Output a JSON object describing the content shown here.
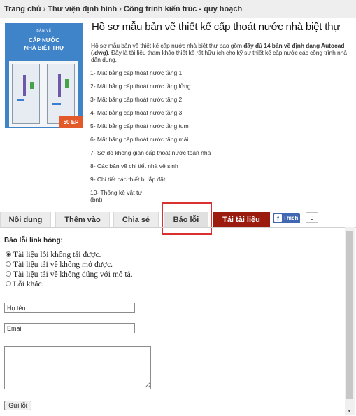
{
  "breadcrumb": {
    "items": [
      "Trang chủ",
      "Thư viện định hình",
      "Công trình kiến trúc - quy hoạch"
    ],
    "separator": "›"
  },
  "thumbnail": {
    "kicker": "BẢN VẼ",
    "title_line1": "CẤP NƯỚC",
    "title_line2": "NHÀ BIỆT THỰ",
    "badge": "50 EP"
  },
  "document": {
    "title": "Hồ sơ mẫu bản vẽ thiết kế cấp thoát nước nhà biệt thự",
    "desc_part1": "Hồ sơ mẫu bản vẽ thiết kế cấp nước nhà biệt thự bao gồm ",
    "desc_bold": "đầy đủ 14 bản vẽ định dạng Autocad (.dwg)",
    "desc_part2": ". Đây là tài liệu tham khảo thiết kế rất hữu ích cho kỹ sư thiết kế cấp nước các công trình nhà dân dụng.",
    "items": [
      "1- Mặt bằng cấp thoát nước tầng 1",
      "2- Mặt bằng cấp thoát nước tầng lửng",
      "3- Mặt bằng cấp thoát nước tầng 2",
      "4- Mặt bằng cấp thoát nước tầng 3",
      "5- Mặt bằng cấp thoát nước tầng tum",
      "6- Mặt bằng cấp thoát nước tầng mái",
      "7- Sơ đồ không gian cấp thoát nước toàn nhà",
      "8- Các bản vẽ chi tiết nhà vệ sinh",
      "9- Chi tiết các thiết bị lắp đặt",
      "10- Thống kê vật tư",
      "(bnt)"
    ]
  },
  "tabs": [
    {
      "label": "Nội dung"
    },
    {
      "label": "Thêm vào"
    },
    {
      "label": "Chia sẻ"
    },
    {
      "label": "Báo lỗi"
    },
    {
      "label": "Tải tài liệu"
    }
  ],
  "facebook": {
    "like_label": "Thích",
    "fb_glyph": "f",
    "count": "0"
  },
  "report_form": {
    "title": "Báo lỗi link hỏng:",
    "options": [
      "Tài liệu lỗi không tải được.",
      "Tài liệu tải về không mở được.",
      "Tài liệu tải về không đúng với mô tả.",
      "Lỗi khác."
    ],
    "selected_index": 0,
    "name_value": "Họ tên",
    "email_value": "Email",
    "message_value": "",
    "submit_label": "Gửi lỗi"
  },
  "colors": {
    "download_tab": "#9b1b0f",
    "highlight_box": "#d93030",
    "facebook": "#4267b2",
    "thumbnail_bg": "#3f83c9",
    "badge": "#e2592a"
  }
}
